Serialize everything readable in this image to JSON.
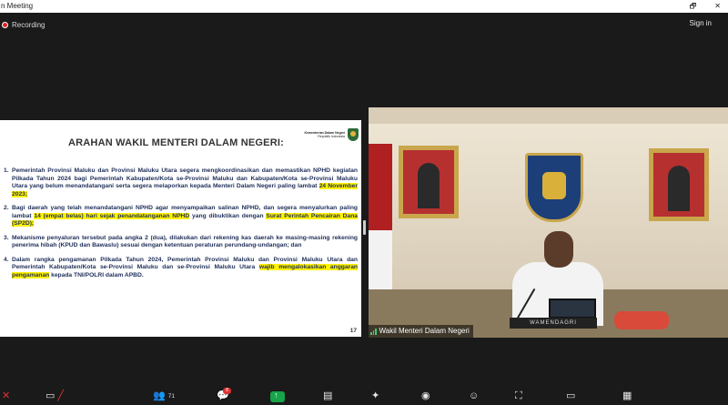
{
  "window": {
    "title": "n Meeting",
    "restore_glyph": "🗗",
    "close_glyph": "✕"
  },
  "recording": {
    "label": "Recording"
  },
  "header": {
    "sign_in": "Sign in"
  },
  "slide": {
    "title": "ARAHAN WAKIL MENTERI DALAM NEGERI:",
    "org_name": "Kementerian Dalam Negeri",
    "org_sub": "Republik Indonesia",
    "page_number": "17",
    "items": [
      {
        "num": "1.",
        "pre": "Pemerintah Provinsi Maluku dan Provinsi Maluku Utara segera mengkoordinasikan dan memastikan NPHD kegiatan Pilkada Tahun 2024 bagi Pemerintah Kabupaten/Kota se-Provinsi Maluku dan Kabupaten/Kota se-Provinsi Maluku Utara yang belum menandatangani serta segera melaporkan kepada Menteri Dalam Negeri paling lambat ",
        "highlight": "24 November 2023;",
        "post": ""
      },
      {
        "num": "2.",
        "pre": "Bagi daerah yang telah menandatangani NPHD agar menyampaikan salinan NPHD, dan segera menyalurkan paling lambat ",
        "highlight": "14 (empat belas) hari sejak penandatanganan NPHD",
        "mid": " yang dibuktikan dengan ",
        "highlight2": "Surat Perintah Pencairan Dana (SP2D);",
        "post": ""
      },
      {
        "num": "3.",
        "pre": "Mekanisme penyaluran tersebut pada angka 2 (dua), dilakukan dari rekening kas daerah ke masing-masing rekening penerima hibah (KPUD dan Bawaslu) sesuai dengan ketentuan peraturan perundang-undangan; dan",
        "highlight": "",
        "post": ""
      },
      {
        "num": "4.",
        "pre": "Dalam rangka pengamanan Pilkada Tahun 2024, Pemerintah Provinsi Maluku dan Provinsi Maluku Utara dan Pemerintah Kabupaten/Kota se-Provinsi Maluku dan se-Provinsi Maluku Utara ",
        "highlight": "wajib mengalokasikan anggaran pengamanan",
        "post": " kepada TNI/POLRI dalam APBD."
      }
    ]
  },
  "video": {
    "participant_name": "Wakil Menteri Dalam Negeri",
    "nameplate": "WAMENDAGRI"
  },
  "toolbar": {
    "participants_count": "71",
    "chat_badge": "8"
  },
  "colors": {
    "highlight": "#fff200",
    "share_green": "#16a34a",
    "recording_red": "#dd2222"
  }
}
